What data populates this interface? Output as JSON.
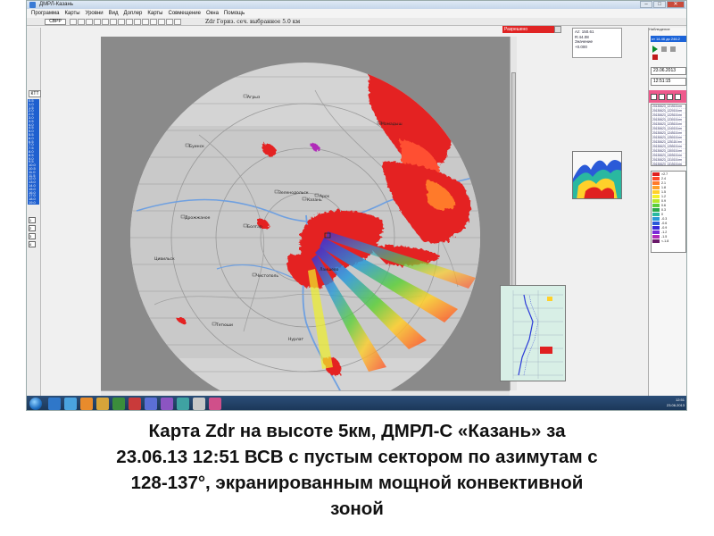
{
  "window": {
    "title": "ДМРЛ-Казань",
    "buttons": [
      "–",
      "□",
      "✕"
    ]
  },
  "menu": [
    "Программа",
    "Карты",
    "Уровни",
    "Вид",
    "Доплер",
    "Карты",
    "Совмещение",
    "Окна",
    "Помощь"
  ],
  "toolbar": {
    "mode_label": "СВРР"
  },
  "map": {
    "caption": "Zdr  Гориз. сеч. выбранное    5.0 км",
    "place_labels": [
      "Зеленодольск",
      "Казань",
      "Лаишево",
      "Агрыз",
      "Арск",
      "Мамадыш",
      "Чистополь",
      "Буинск",
      "Тетюши",
      "Болгар",
      "Дрожжаное",
      "Цивильск",
      "Нурлат"
    ]
  },
  "status": {
    "red_label": "Разрешено"
  },
  "left_panel": {
    "button_label": "КТТ",
    "heights": [
      "0.5",
      "1.0",
      "1.5",
      "2.0",
      "2.5",
      "3.0",
      "3.5",
      "4.0",
      "4.5",
      "5.0",
      "5.5",
      "6.0",
      "6.5",
      "7.0",
      "7.5",
      "8.0",
      "8.5",
      "9.0",
      "9.5",
      "10.0",
      "10.5",
      "11.0",
      "11.5",
      "12.0",
      "13.0",
      "14.0",
      "15.0",
      "16.0",
      "17.0",
      "18.0",
      "19.0",
      "20.0",
      "21.0",
      "22.0",
      "23.0",
      "24.0",
      "25.0",
      "26.0",
      "27.0",
      "28.0",
      "29.0",
      "30.0"
    ],
    "checkboxes": [
      "1",
      "2",
      "3",
      "4"
    ]
  },
  "info_box": {
    "lines": [
      "Az: 150.61",
      "R:44.08",
      "Значение",
      "+0.000"
    ]
  },
  "forecast_panel": {
    "header": "Наблюдение",
    "selected": "от 14.46 до 246.2",
    "date": "23.06.2013",
    "time": "12:51:15",
    "files": [
      "20130623_121515.Irm",
      "20130623_122015.Irm",
      "20130623_122515.Irm",
      "20130623_123015.Irm",
      "20130623_123515.Irm",
      "20130623_124015.Irm",
      "20130623_124515.Irm",
      "20130623_125015.Irm",
      "20130623_125115.Irm",
      "20130623_125515.Irm",
      "20130623_130015.Irm",
      "20130623_130515.Irm",
      "20130623_131015.Irm",
      "20130623_131515.Irm",
      "20130623_132015.Irm",
      "20130623_132515.Irm"
    ]
  },
  "legend": {
    "items": [
      {
        "label": ">2.7",
        "color": "#e02020"
      },
      {
        "label": "2.4",
        "color": "#ff4a2a"
      },
      {
        "label": "2.1",
        "color": "#ff7a2a"
      },
      {
        "label": "1.8",
        "color": "#ffa02a"
      },
      {
        "label": "1.5",
        "color": "#ffd02a"
      },
      {
        "label": "1.2",
        "color": "#f5f02a"
      },
      {
        "label": "0.9",
        "color": "#b8e82a"
      },
      {
        "label": "0.6",
        "color": "#5ccf3a"
      },
      {
        "label": "0.3",
        "color": "#2aa84a"
      },
      {
        "label": "0",
        "color": "#2ab8a0"
      },
      {
        "label": "-0.3",
        "color": "#2a9ad8"
      },
      {
        "label": "-0.6",
        "color": "#2a5ad8"
      },
      {
        "label": "-0.9",
        "color": "#3a2ad8"
      },
      {
        "label": "-1.2",
        "color": "#7a2ad8"
      },
      {
        "label": "-1.5",
        "color": "#b02ab8"
      },
      {
        "label": "<-1.8",
        "color": "#6a1a6a"
      }
    ]
  },
  "taskbar": {
    "clock": "12:51",
    "date": "23.06.2013"
  },
  "slide_caption": {
    "line1": "Карта Zdr на высоте 5км, ДМРЛ-С «Казань»  за",
    "line2": "23.06.13 12:51 ВСВ с пустым сектором по азимутам с",
    "line3": "128-137°, экранированным мощной конвективной",
    "line4": "зоной"
  }
}
